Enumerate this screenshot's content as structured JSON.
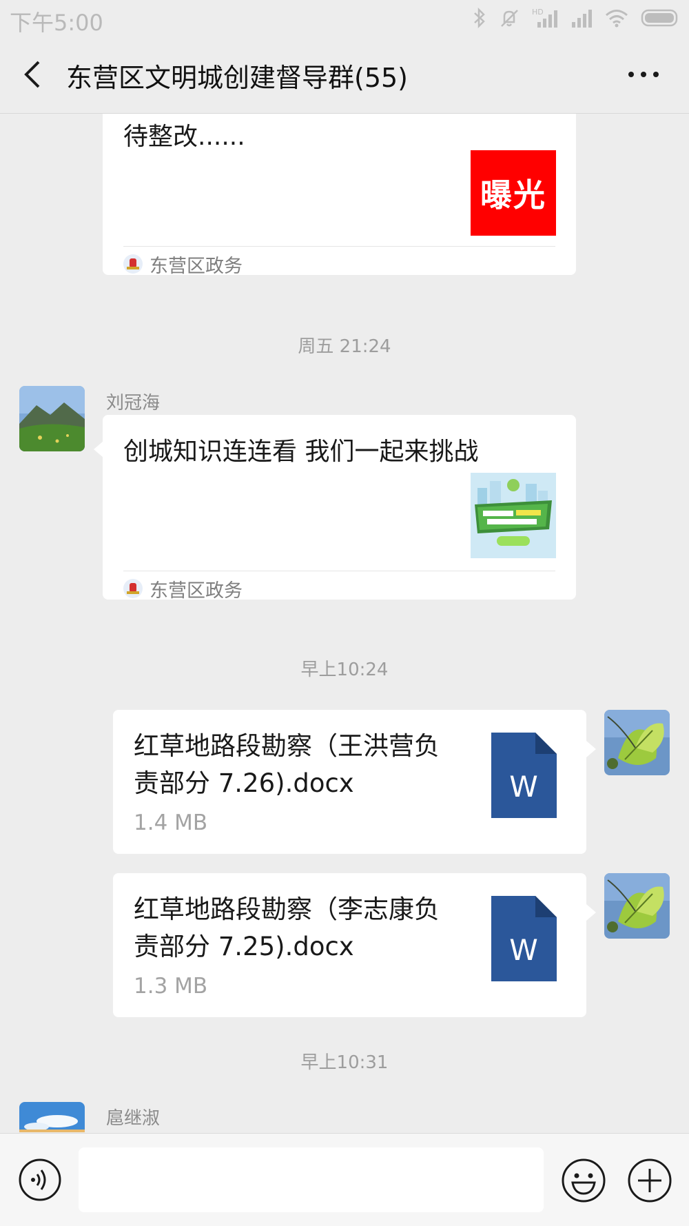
{
  "status_bar": {
    "time": "下午5:00",
    "network_label": "HD"
  },
  "header": {
    "title": "东营区文明城创建督导群(55)",
    "back_icon": "chevron-left-icon",
    "more_icon": "more-horizontal-icon"
  },
  "messages": {
    "card1": {
      "desc_tail": "待整改......",
      "thumb_text": "曝光",
      "thumb_color": "#ff0000",
      "source": "东营区政务"
    },
    "ts1": "周五 21:24",
    "card2": {
      "sender": "刘冠海",
      "desc": "创城知识连连看 我们一起来挑战",
      "source": "东营区政务"
    },
    "ts2": "早上10:24",
    "file1": {
      "name": "红草地路段勘察（王洪营负责部分 7.26).docx",
      "size": "1.4 MB",
      "icon_letter": "W"
    },
    "file2": {
      "name": "红草地路段勘察（李志康负责部分 7.25).docx",
      "size": "1.3 MB",
      "icon_letter": "W"
    },
    "ts3": "早上10:31",
    "sender3": "扈继淑"
  },
  "input_bar": {
    "voice_icon": "voice-icon",
    "emoji_icon": "emoji-icon",
    "plus_icon": "plus-icon"
  },
  "colors": {
    "word_blue": "#2b579a",
    "background": "#ededed"
  }
}
